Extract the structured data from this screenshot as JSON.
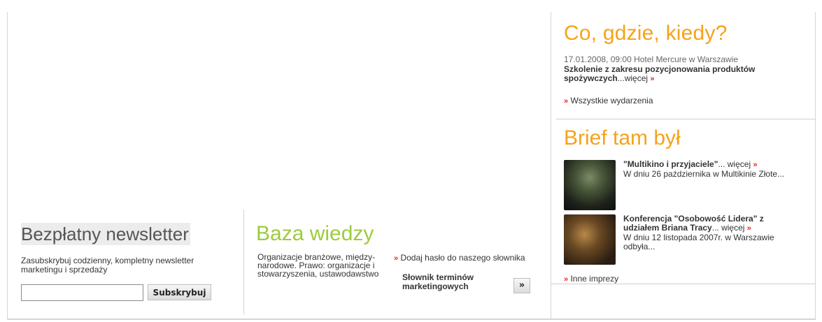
{
  "events": {
    "title": "Co, gdzie, kiedy?",
    "item": {
      "meta": "17.01.2008, 09:00 Hotel Mercure w Warszawie",
      "title": "Szkolenie z zakresu pozycjonowania produktów spożywczych",
      "more": "...więcej",
      "arrow": "»"
    },
    "all_arrow": "»",
    "all_label": "Wszystkie wydarzenia"
  },
  "brief": {
    "title": "Brief tam był",
    "items": [
      {
        "title": "\"Multikino i przyjaciele\"",
        "more": "... więcej",
        "arrow": "»",
        "desc": "W dniu 26 października w Multikinie Złote..."
      },
      {
        "title": "Konferencja \"Osobowość Lidera\" z udziałem Briana Tracy",
        "more": "... więcej",
        "arrow": "»",
        "desc": "W dniu 12 listopada 2007r. w Warszawie odbyła..."
      }
    ],
    "other_arrow": "»",
    "other_label": "Inne imprezy"
  },
  "newsletter": {
    "title": "Bezpłatny newsletter",
    "desc": "Zasubskrybuj codzienny, kompletny newsletter marketingu i sprzedaży",
    "input_value": "",
    "button": "Subskrybuj"
  },
  "knowledge": {
    "title": "Baza wiedzy",
    "desc": "Organizacje branżowe, między-narodowe. Prawo: organizacje i stowarzyszenia, ustawodawstwo",
    "add_arrow": "»",
    "add_label": "Dodaj hasło do naszego słownika",
    "dict_label": "Słownik terminów marketingowych",
    "go_button": "»"
  },
  "colors": {
    "orange_heading": "#f6a21a",
    "green_heading": "#9ccc3c",
    "arrow_red": "#e2261f"
  }
}
